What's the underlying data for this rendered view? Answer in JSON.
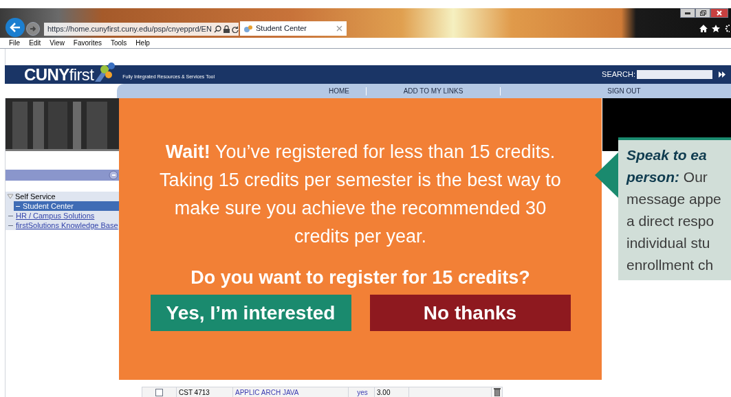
{
  "browser": {
    "address": "https://home.cunyfirst.cuny.edu/psp/cnyepprd/EN",
    "tabs": [
      {
        "title": "Student Center",
        "selected": true
      }
    ],
    "menu": [
      "File",
      "Edit",
      "View",
      "Favorites",
      "Tools",
      "Help"
    ]
  },
  "header": {
    "logo_bold": "CUNY",
    "logo_light": "first",
    "tagline": "Fully Integrated Resources & Services Tool",
    "search_label": "SEARCH:"
  },
  "nav": [
    "HOME",
    "ADD TO MY LINKS",
    "SIGN OUT"
  ],
  "sidebar": {
    "items": [
      {
        "label": "Self Service",
        "kind": "folder",
        "expanded": true,
        "selected": false,
        "children": [
          {
            "label": "Student Center",
            "kind": "link",
            "selected": true
          }
        ]
      },
      {
        "label": "HR / Campus Solutions",
        "kind": "link",
        "selected": false
      },
      {
        "label": "firstSolutions Knowledge Base",
        "kind": "link",
        "selected": false
      }
    ]
  },
  "table": {
    "rows": [
      {
        "checked": false,
        "cells": [
          "CST 4713",
          "APPLIC ARCH JAVA",
          "yes",
          "3.00"
        ]
      }
    ]
  },
  "overlay": {
    "message": "**Wait!** You’ve registered for less than 15 credits. Taking 15 credits per semester is the best way to make sure you achieve the recommended 30 credits per year.",
    "question": "Do you want to register for 15 credits?",
    "buttons": [
      {
        "label": "Yes, I’m interested",
        "kind": "accept"
      },
      {
        "label": "No thanks",
        "kind": "decline"
      }
    ]
  },
  "callout": {
    "heading_lines": [
      "Speak to ea",
      "person:"
    ],
    "body_lines": [
      "Our",
      "message appe",
      "a direct respo",
      "individual stu",
      "enrollment ch"
    ]
  }
}
